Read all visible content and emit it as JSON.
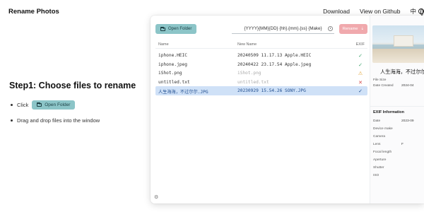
{
  "brand": "Rename Photos",
  "nav": {
    "download": "Download",
    "github": "View on Github",
    "lang": "中"
  },
  "hero": {
    "title": "Step1: Choose files to rename",
    "step_click": "Click",
    "open_button": "Open Folder",
    "step_drag": "Drag and drop files into the window"
  },
  "app": {
    "open_button": "Open Folder",
    "pattern": "{YYYY}{MM}{DD} {hh}.{mm}.{ss} {Make}",
    "rename_button": "Rename",
    "columns": {
      "name": "Name",
      "new_name": "New Name",
      "exif": "EXIF"
    },
    "rows": [
      {
        "name": "iphone.HEIC",
        "new_name": "20240509 11.17.13 Apple.HEIC",
        "status": "ok",
        "status_icon": "check-icon"
      },
      {
        "name": "iphone.jpeg",
        "new_name": "20240422 23.17.54 Apple.jpeg",
        "status": "ok",
        "status_icon": "check-icon"
      },
      {
        "name": "iShot.png",
        "new_name": "iShot.png",
        "status": "warn",
        "status_icon": "warning-icon"
      },
      {
        "name": "untitled.txt",
        "new_name": "untitled.txt",
        "status": "err",
        "status_icon": "x-icon"
      },
      {
        "name": "人生海海，不过尔尔.JPG",
        "new_name": "20230929 15.54.26 SONY.JPG",
        "status": "ok",
        "status_icon": "check-icon"
      }
    ],
    "selected_row": 4
  },
  "side": {
    "photo_title": "人生海海，不过尔尔",
    "file_size_label": "File Size",
    "date_created_label": "Date Created",
    "date_created_value": "2024-04",
    "exif_title": "EXIF Information",
    "date_label": "Date",
    "date_value": "2023-09",
    "device_make_label": "Device make",
    "camera_label": "Camera",
    "lens_label": "Lens",
    "lens_value": "F",
    "focal_length_label": "Focal length",
    "aperture_label": "Aperture",
    "shutter_label": "Shutter",
    "iso_label": "ISO"
  },
  "colors": {
    "accent": "#8cc5c8",
    "rename": "#f0a9ad",
    "selected_row": "#cfe1f7",
    "ok": "#3aa36a",
    "warn": "#e0a030",
    "err": "#d24a4a"
  }
}
